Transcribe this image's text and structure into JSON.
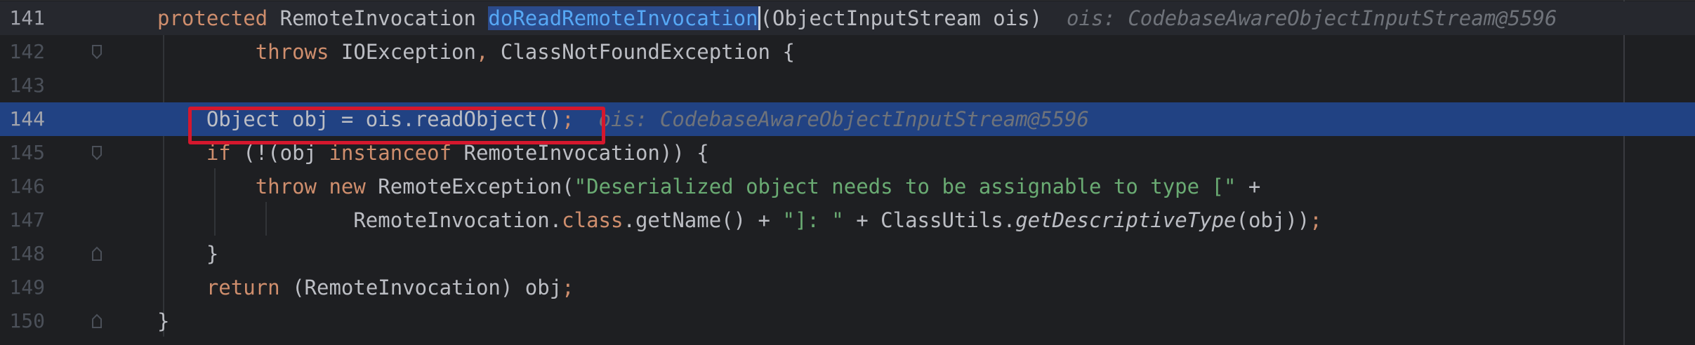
{
  "editor": {
    "lines": [
      {
        "no": "141",
        "parts": [
          {
            "t": "protected ",
            "c": "kw"
          },
          {
            "t": "RemoteInvocation "
          },
          {
            "t": "doReadRemoteInvocation",
            "c": "sel"
          },
          {
            "t": "(ObjectInputStream ois)"
          },
          {
            "t": "  ois: CodebaseAwareObjectInputStream@5596",
            "c": "hint"
          }
        ]
      },
      {
        "no": "142",
        "parts": [
          {
            "t": "        "
          },
          {
            "t": "throws ",
            "c": "kw"
          },
          {
            "t": "IOException"
          },
          {
            "t": ", ",
            "c": "kw"
          },
          {
            "t": "ClassNotFoundException {"
          }
        ]
      },
      {
        "no": "143",
        "parts": []
      },
      {
        "no": "144",
        "parts": [
          {
            "t": "    Object obj = ois.readObject()"
          },
          {
            "t": ";",
            "c": "kw"
          },
          {
            "t": "  ois: CodebaseAwareObjectInputStream@5596",
            "c": "hint"
          }
        ]
      },
      {
        "no": "145",
        "parts": [
          {
            "t": "    "
          },
          {
            "t": "if ",
            "c": "kw"
          },
          {
            "t": "(!(obj "
          },
          {
            "t": "instanceof ",
            "c": "kw"
          },
          {
            "t": "RemoteInvocation)) {"
          }
        ]
      },
      {
        "no": "146",
        "parts": [
          {
            "t": "        "
          },
          {
            "t": "throw new ",
            "c": "kw"
          },
          {
            "t": "RemoteException("
          },
          {
            "t": "\"Deserialized object needs to be assignable to type [\"",
            "c": "str"
          },
          {
            "t": " +"
          }
        ]
      },
      {
        "no": "147",
        "parts": [
          {
            "t": "                RemoteInvocation."
          },
          {
            "t": "class",
            "c": "kw"
          },
          {
            "t": ".getName() + "
          },
          {
            "t": "\"]: \"",
            "c": "str"
          },
          {
            "t": " + ClassUtils."
          },
          {
            "t": "getDescriptiveType",
            "c": "it"
          },
          {
            "t": "(obj))"
          },
          {
            "t": ";",
            "c": "kw"
          }
        ]
      },
      {
        "no": "148",
        "parts": [
          {
            "t": "    }"
          }
        ]
      },
      {
        "no": "149",
        "parts": [
          {
            "t": "    "
          },
          {
            "t": "return ",
            "c": "kw"
          },
          {
            "t": "(RemoteInvocation) obj"
          },
          {
            "t": ";",
            "c": "kw"
          }
        ]
      },
      {
        "no": "150",
        "parts": [
          {
            "t": "}"
          }
        ]
      }
    ]
  },
  "colors": {
    "background": "#1e1f22",
    "keyword": "#cf8e6d",
    "string": "#6aab73",
    "execution_line": "#214283",
    "highlight_box": "#d5172d"
  }
}
